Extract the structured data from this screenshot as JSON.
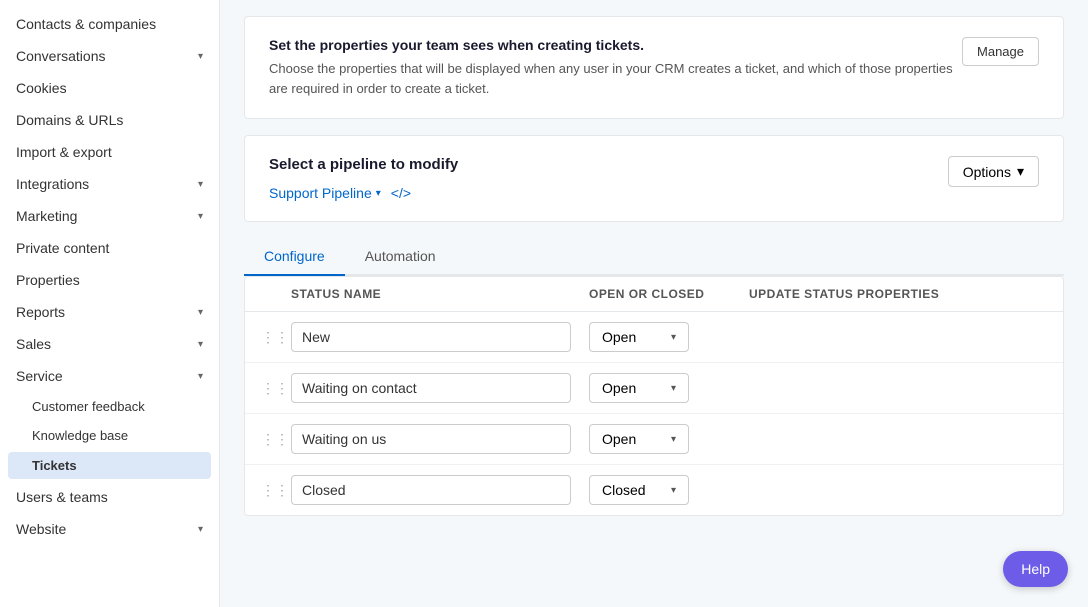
{
  "sidebar": {
    "items": [
      {
        "label": "Contacts & companies",
        "hasArrow": false,
        "active": false
      },
      {
        "label": "Conversations",
        "hasArrow": true,
        "active": false
      },
      {
        "label": "Cookies",
        "hasArrow": false,
        "active": false
      },
      {
        "label": "Domains & URLs",
        "hasArrow": false,
        "active": false
      },
      {
        "label": "Import & export",
        "hasArrow": false,
        "active": false
      },
      {
        "label": "Integrations",
        "hasArrow": true,
        "active": false
      },
      {
        "label": "Marketing",
        "hasArrow": true,
        "active": false
      },
      {
        "label": "Private content",
        "hasArrow": false,
        "active": false
      },
      {
        "label": "Properties",
        "hasArrow": false,
        "active": false
      },
      {
        "label": "Reports",
        "hasArrow": true,
        "active": false
      },
      {
        "label": "Sales",
        "hasArrow": true,
        "active": false
      },
      {
        "label": "Service",
        "hasArrow": true,
        "active": true
      },
      {
        "label": "Users & teams",
        "hasArrow": false,
        "active": false
      },
      {
        "label": "Website",
        "hasArrow": true,
        "active": false
      }
    ],
    "service_sub_items": [
      {
        "label": "Customer feedback",
        "active": false
      },
      {
        "label": "Knowledge base",
        "active": false
      },
      {
        "label": "Tickets",
        "active": true
      }
    ]
  },
  "info_manage": {
    "title": "Set the properties your team sees when creating tickets.",
    "description": "Choose the properties that will be displayed when any user in your CRM creates a ticket, and which of those properties are required in order to create a ticket.",
    "button_label": "Manage"
  },
  "pipeline": {
    "title": "Select a pipeline to modify",
    "pipeline_name": "Support Pipeline",
    "options_label": "Options"
  },
  "tabs": [
    {
      "label": "Configure",
      "active": true
    },
    {
      "label": "Automation",
      "active": false
    }
  ],
  "table": {
    "columns": [
      "",
      "STATUS NAME",
      "OPEN OR CLOSED",
      "UPDATE STATUS PROPERTIES"
    ],
    "rows": [
      {
        "status": "New",
        "open_closed": "Open",
        "is_closed": false
      },
      {
        "status": "Waiting on contact",
        "open_closed": "Open",
        "is_closed": false
      },
      {
        "status": "Waiting on us",
        "open_closed": "Open",
        "is_closed": false
      },
      {
        "status": "Closed",
        "open_closed": "Closed",
        "is_closed": true
      }
    ]
  },
  "help": {
    "label": "Help"
  }
}
